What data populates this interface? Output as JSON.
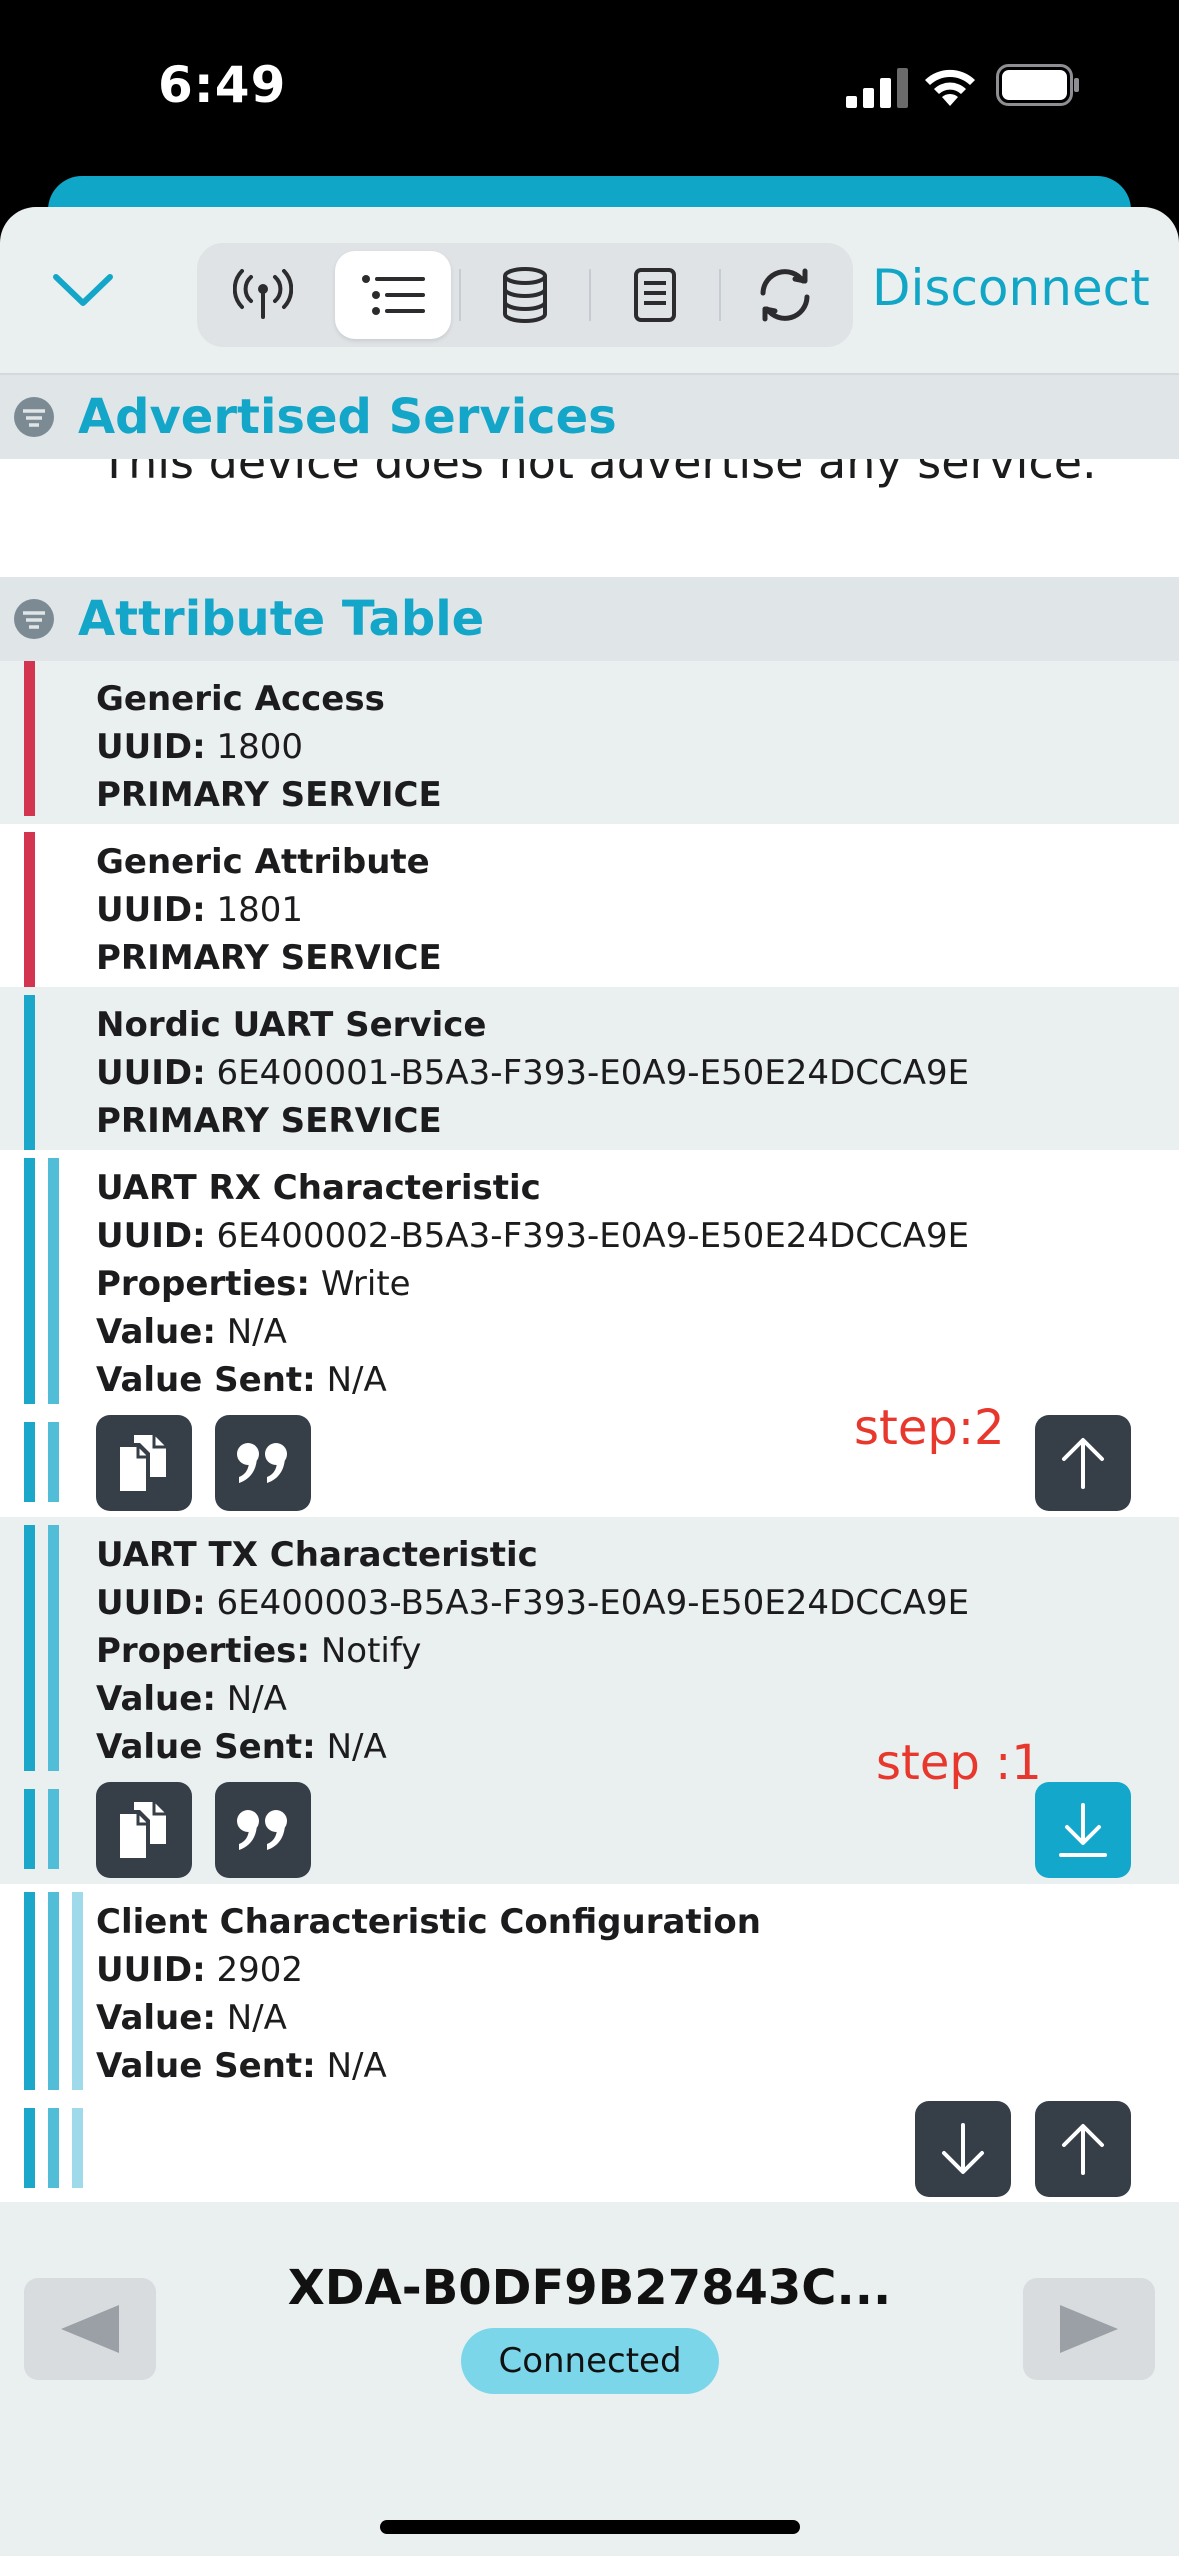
{
  "status": {
    "time": "6:49"
  },
  "toolbar": {
    "disconnect_label": "Disconnect",
    "segments": [
      "signal-icon",
      "list-icon",
      "database-icon",
      "log-icon",
      "refresh-icon"
    ],
    "active_segment": "list-icon"
  },
  "advertised": {
    "title": "Advertised Services",
    "text": "This device does not advertise any service."
  },
  "attributes": {
    "title": "Attribute Table",
    "uuid_label": "UUID:",
    "properties_label": "Properties:",
    "value_label": "Value:",
    "value_sent_label": "Value Sent:",
    "items": [
      {
        "name": "Generic Access",
        "uuid": "1800",
        "type": "PRIMARY SERVICE"
      },
      {
        "name": "Generic Attribute",
        "uuid": "1801",
        "type": "PRIMARY SERVICE"
      },
      {
        "name": "Nordic UART Service",
        "uuid": "6E400001-B5A3-F393-E0A9-E50E24DCCA9E",
        "type": "PRIMARY SERVICE"
      },
      {
        "name": "UART RX Characteristic",
        "uuid": "6E400002-B5A3-F393-E0A9-E50E24DCCA9E",
        "properties": "Write",
        "value": "N/A",
        "value_sent": "N/A",
        "note": "step:2"
      },
      {
        "name": "UART TX Characteristic",
        "uuid": "6E400003-B5A3-F393-E0A9-E50E24DCCA9E",
        "properties": "Notify",
        "value": "N/A",
        "value_sent": "N/A",
        "note": "step :1"
      },
      {
        "name": "Client Characteristic Configuration",
        "uuid": "2902",
        "value": "N/A",
        "value_sent": "N/A"
      }
    ]
  },
  "footer": {
    "device_name": "XDA-B0DF9B27843C...",
    "connection_status": "Connected"
  },
  "colors": {
    "accent": "#13a6c8",
    "service_red": "#d3344f",
    "button_dark": "#363f48",
    "annotation_red": "#e8382d"
  }
}
